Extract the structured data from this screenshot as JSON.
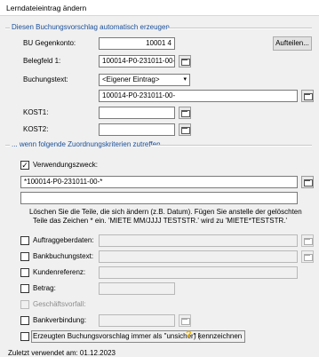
{
  "window": {
    "title": "Lerndateieintrag ändern"
  },
  "group1": {
    "title": "Diesen Buchungsvorschlag automatisch erzeugen..."
  },
  "fields": {
    "bu_gegenkonto": {
      "label": "BU Gegenkonto:",
      "value": "10001 4"
    },
    "belegfeld1": {
      "label": "Belegfeld 1:",
      "value": "100014-P0-231011-00-"
    },
    "buchungstext": {
      "label": "Buchungstext:",
      "selected": "<Eigener Eintrag>",
      "value": "100014-P0-231011-00-"
    },
    "kost1": {
      "label": "KOST1:",
      "value": ""
    },
    "kost2": {
      "label": "KOST2:",
      "value": ""
    }
  },
  "buttons": {
    "aufteilen": "Aufteilen..."
  },
  "group2": {
    "title": "... wenn folgende Zuordnungskriterien zutreffen"
  },
  "criteria": {
    "verwendungszweck": {
      "label": "Verwendungszweck:",
      "checked": true,
      "value": "*100014-P0-231011-00-*",
      "value2": ""
    },
    "note_line1": "Löschen Sie die Teile, die sich ändern (z.B. Datum). Fügen Sie anstelle der gelöschten",
    "note_line2": "Teile das Zeichen * ein. 'MIETE MM/JJJJ TESTSTR.' wird zu 'MIETE*TESTSTR.'",
    "auftraggeberdaten": {
      "label": "Auftraggeberdaten:",
      "checked": false
    },
    "bankbuchungstext": {
      "label": "Bankbuchungstext:",
      "checked": false
    },
    "kundenreferenz": {
      "label": "Kundenreferenz:",
      "checked": false
    },
    "betrag": {
      "label": "Betrag:",
      "checked": false
    },
    "geschaeftsvorfall": {
      "label": "Geschäftsvorfall:",
      "checked": false
    },
    "bankverbindung": {
      "label": "Bankverbindung:",
      "checked": false
    },
    "unsicher": {
      "label_pre": "Erzeugten Buchungsvorschlag immer als \"unsicher\" (",
      "label_post": ") kennzeichnen",
      "checked": false
    }
  },
  "footer": {
    "last_used": "Zuletzt verwendet am:   01.12.2023"
  },
  "icons": {
    "question": "?",
    "check": "✓",
    "dropdown_arrow": "▾"
  }
}
